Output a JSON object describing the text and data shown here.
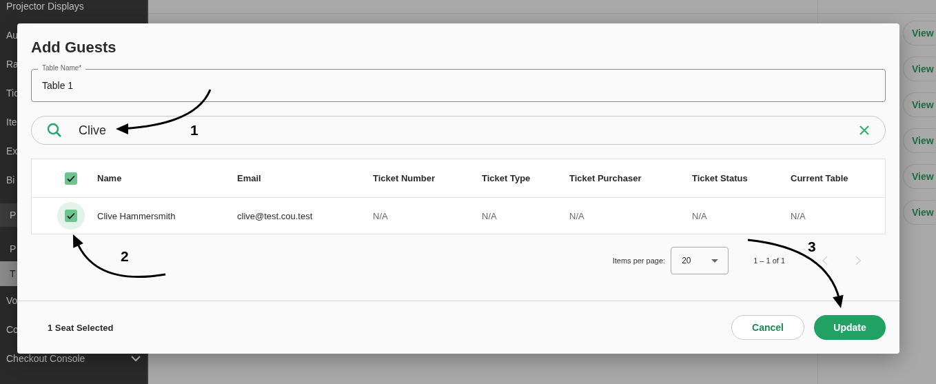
{
  "sidebar": {
    "items": [
      {
        "label": "Projector Displays",
        "kind": "item",
        "selected": false
      },
      {
        "label": "Au",
        "kind": "item",
        "selected": false
      },
      {
        "label": "Ra",
        "kind": "item",
        "selected": false
      },
      {
        "label": "Tic",
        "kind": "item",
        "selected": false
      },
      {
        "label": "Ite",
        "kind": "item",
        "selected": false
      },
      {
        "label": "Ex",
        "kind": "item",
        "selected": false
      },
      {
        "label": "Bi",
        "kind": "item",
        "selected": false
      },
      {
        "label": "P",
        "kind": "group",
        "selected": false
      },
      {
        "label": "P",
        "kind": "subitem",
        "selected": false
      },
      {
        "label": "T",
        "kind": "subitem",
        "selected": true
      },
      {
        "label": "Vo",
        "kind": "item",
        "selected": false
      },
      {
        "label": "Co",
        "kind": "item",
        "selected": false
      },
      {
        "label": "Checkout Console",
        "kind": "menu",
        "selected": false
      }
    ]
  },
  "background_table": {
    "row_actions": [
      "View",
      "View",
      "View",
      "View",
      "View",
      "View"
    ]
  },
  "dialog": {
    "title": "Add Guests",
    "table_name": {
      "label": "Table Name*",
      "value": "Table 1"
    },
    "search": {
      "value": "Clive"
    },
    "table": {
      "select_all_checked": true,
      "columns": [
        "Name",
        "Email",
        "Ticket Number",
        "Ticket Type",
        "Ticket Purchaser",
        "Ticket Status",
        "Current Table"
      ],
      "rows": [
        {
          "checked": true,
          "cells": [
            "Clive Hammersmith",
            "clive@test.cou.test",
            "N/A",
            "N/A",
            "N/A",
            "N/A",
            "N/A"
          ]
        }
      ]
    },
    "pagination": {
      "label": "Items per page:",
      "page_size": "20",
      "range": "1 – 1 of 1",
      "prev_disabled": true,
      "next_disabled": true
    },
    "footer": {
      "status": "1 Seat Selected",
      "cancel": "Cancel",
      "update": "Update"
    }
  },
  "annotations": [
    {
      "label": "1"
    },
    {
      "label": "2"
    },
    {
      "label": "3"
    }
  ]
}
